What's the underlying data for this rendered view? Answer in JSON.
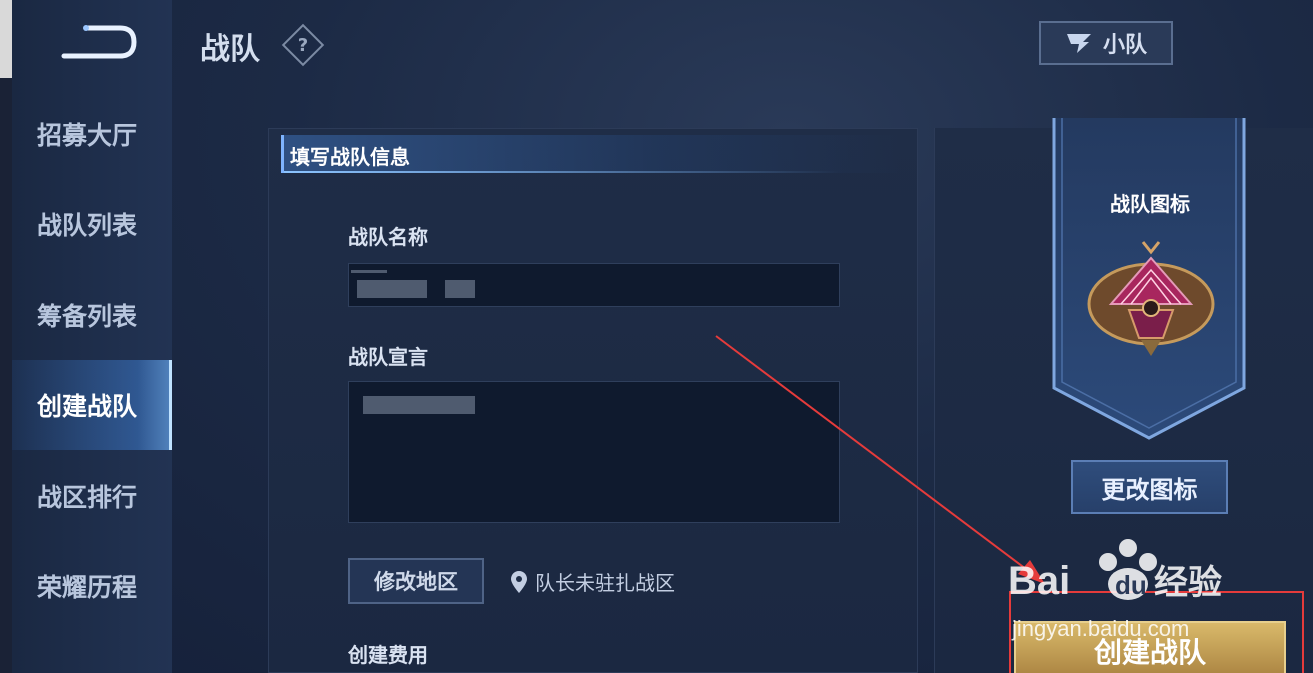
{
  "header": {
    "title": "战队",
    "help_glyph": "?",
    "squad_button_label": "小队"
  },
  "sidebar": {
    "items": [
      {
        "label": "招募大厅",
        "active": false
      },
      {
        "label": "战队列表",
        "active": false
      },
      {
        "label": "筹备列表",
        "active": false
      },
      {
        "label": "创建战队",
        "active": true
      },
      {
        "label": "战区排行",
        "active": false
      },
      {
        "label": "荣耀历程",
        "active": false
      }
    ]
  },
  "form": {
    "section_title": "填写战队信息",
    "name_label": "战队名称",
    "name_value": "",
    "declaration_label": "战队宣言",
    "declaration_value": "",
    "modify_region_label": "修改地区",
    "location_text": "队长未驻扎战区",
    "cost_label": "创建费用"
  },
  "icon_panel": {
    "title": "战队图标",
    "change_button_label": "更改图标"
  },
  "create_button_label": "创建战队",
  "watermark": {
    "brand_bai": "Bai",
    "brand_du": "du",
    "brand_suffix": "经验",
    "url": "jingyan.baidu.com"
  },
  "colors": {
    "accent": "#7fb4ff",
    "gold": "#c9a456",
    "annotation_red": "#e53b3b"
  }
}
